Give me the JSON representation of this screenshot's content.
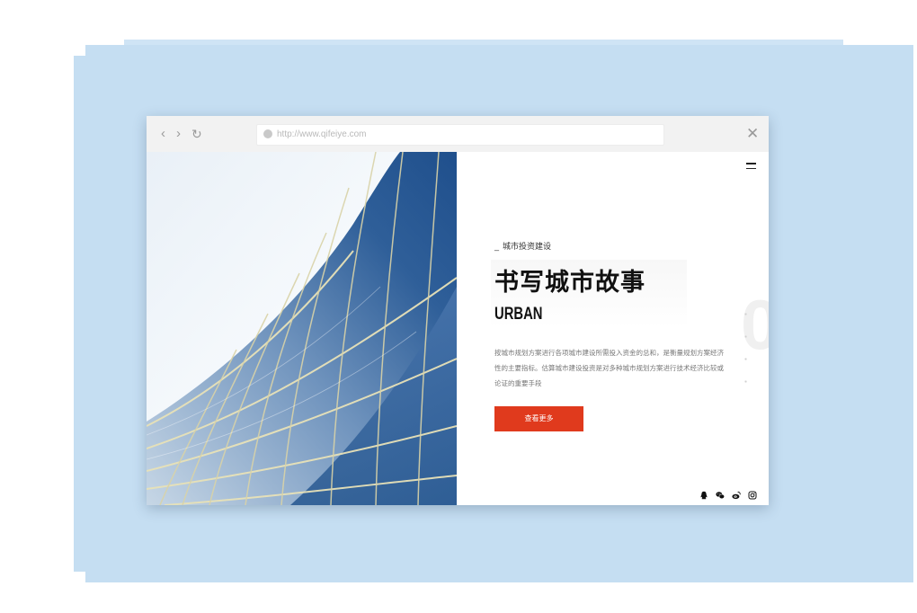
{
  "browser": {
    "url": "http://www.qifeiye.com"
  },
  "page": {
    "kicker": "城市投资建设",
    "title": "书写城市故事",
    "subtitle": "URBAN",
    "description": "按城市规划方案进行各项城市建设所需投入资金的总和，是衡量规划方案经济性的主要指标。估算城市建设投资是对多种城市规划方案进行技术经济比较或论证的重要手段",
    "cta_label": "查看更多"
  },
  "icons": {
    "back": "chevron-left-icon",
    "forward": "chevron-right-icon",
    "reload": "reload-icon",
    "globe": "globe-icon",
    "close": "close-icon",
    "menu": "hamburger-menu-icon",
    "social": [
      "qq-icon",
      "wechat-icon",
      "weibo-icon",
      "instagram-icon"
    ]
  },
  "colors": {
    "accent": "#e03a1d",
    "backdrop": "#c5def2"
  }
}
